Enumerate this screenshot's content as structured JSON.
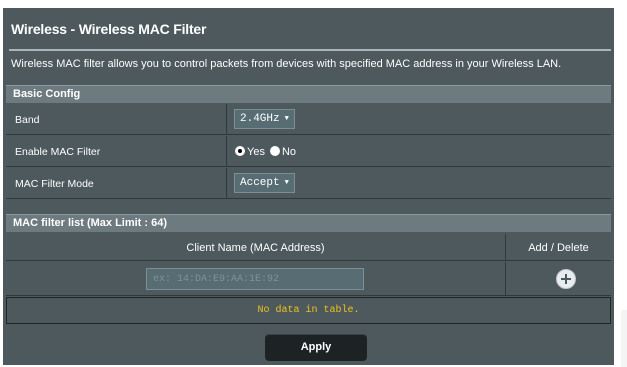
{
  "page": {
    "title": "Wireless - Wireless MAC Filter",
    "description": "Wireless MAC filter allows you to control packets from devices with specified MAC address in your Wireless LAN."
  },
  "basic_config": {
    "header": "Basic Config",
    "band": {
      "label": "Band",
      "value": "2.4GHz"
    },
    "enable_mac_filter": {
      "label": "Enable MAC Filter",
      "options": [
        "Yes",
        "No"
      ],
      "selected": "Yes"
    },
    "mac_filter_mode": {
      "label": "MAC Filter Mode",
      "value": "Accept"
    }
  },
  "mac_list": {
    "header": "MAC filter list (Max Limit : 64)",
    "columns": [
      "Client Name (MAC Address)",
      "Add / Delete"
    ],
    "input_placeholder": "ex: 14:DA:E9:AA:1E:92",
    "empty_message": "No data in table."
  },
  "actions": {
    "apply_label": "Apply"
  },
  "icons": {
    "add": "add-circle-icon",
    "caret": "caret-down-icon"
  },
  "colors": {
    "panel_bg": "#4d595d",
    "header_bg": "#6d7a7f",
    "empty_text": "#f0c020",
    "button_bg": "#1d2325"
  }
}
